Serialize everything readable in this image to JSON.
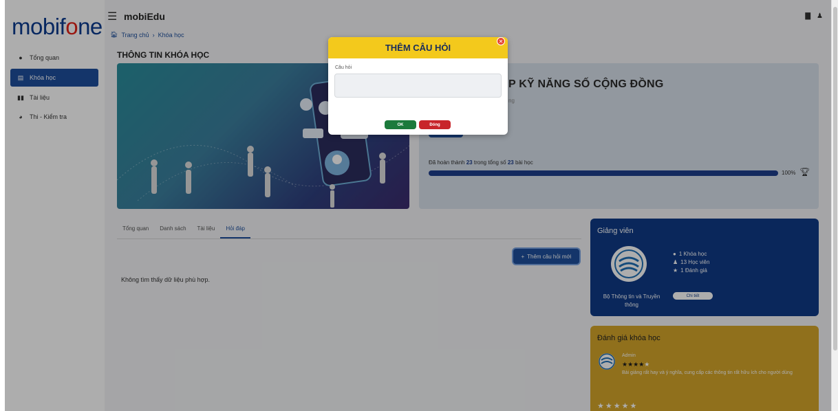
{
  "brand": {
    "logo_prefix": "mobif",
    "logo_o": "o",
    "logo_suffix": "ne"
  },
  "sidebar": {
    "items": [
      {
        "label": "Tổng quan",
        "icon": "info-circle-icon"
      },
      {
        "label": "Khóa học",
        "icon": "list-icon",
        "active": true
      },
      {
        "label": "Tài liệu",
        "icon": "book-icon"
      },
      {
        "label": "Thi - Kiểm tra",
        "icon": "clock-icon"
      }
    ]
  },
  "header": {
    "app_title": "mobiEdu",
    "breadcrumbs": [
      "Trang chủ",
      "Khóa học"
    ]
  },
  "section_title": "THÔNG TIN KHÓA HỌC",
  "course": {
    "title_visible": "P KỸ NĂNG SỐ CỘNG ĐỒNG",
    "subtitle_visible": "ng",
    "progress_prefix": "Đã hoàn thành",
    "completed": "23",
    "progress_middle": "trong tổng số",
    "total": "23",
    "progress_suffix": "bài học",
    "progress_percent": "100%",
    "progress_fraction": 1.0
  },
  "tabs": [
    "Tổng quan",
    "Danh sách",
    "Tài liệu",
    "Hỏi đáp"
  ],
  "active_tab": "Hỏi đáp",
  "add_question_label": "Thêm câu hỏi mới",
  "empty_message": "Không tìm thấy dữ liệu phù hợp.",
  "lecturer": {
    "header": "Giảng viên",
    "name": "Bộ Thông tin và Truyền thông",
    "stats": [
      "1 Khóa học",
      "13 Học viên",
      "1 Đánh giá"
    ],
    "detail_label": "Chi tiết"
  },
  "review": {
    "header": "Đánh giá khóa học",
    "author": "Admin",
    "stars": "★★★★",
    "empty_star": "★",
    "text": "Bài giảng rất hay và ý nghĩa, cung cấp các thông tin rất hữu ích cho người dùng",
    "rating_row": "★★★★★"
  },
  "modal": {
    "title": "THÊM CÂU HỎI",
    "field_label": "Câu hỏi",
    "field_value": "",
    "ok_label": "OK",
    "cancel_label": "Đóng"
  },
  "colors": {
    "primary": "#1e4f9c",
    "modal_header": "#f3c91c",
    "ok": "#1c7a3c",
    "cancel": "#c8252b",
    "review_card": "#d4a52a",
    "lecturer_card": "#0f3a87"
  }
}
